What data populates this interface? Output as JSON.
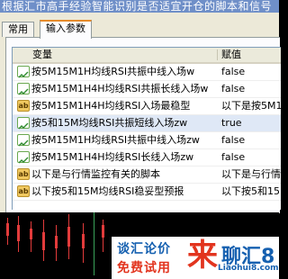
{
  "window": {
    "title": "根据汇市高手经验智能识别是否适宜开仓的脚本和信号"
  },
  "tabs": [
    {
      "label": "常用"
    },
    {
      "label": "输入参数"
    }
  ],
  "table": {
    "columns": [
      "变量",
      "赋值"
    ],
    "rows": [
      {
        "icon": "chart-icon",
        "name": "按5M15M1H均线RSI共振中线入场w",
        "value": "false"
      },
      {
        "icon": "chart-icon",
        "name": "按5M15M1H4H均线RSI共振长线入场w",
        "value": "false"
      },
      {
        "icon": "ab-icon",
        "name": "按5M15M1H4H均线RSI入场最稳型",
        "value": "以下是按5M15M"
      },
      {
        "icon": "chart-icon",
        "name": "按5和15M均线RSI共振短线入场zw",
        "value": "true",
        "selected": true
      },
      {
        "icon": "chart-icon",
        "name": "按5M15M1H均线RSI共振中线入场zw",
        "value": "false"
      },
      {
        "icon": "chart-icon",
        "name": "按5M15M1H4H均线RSI长线入场zw",
        "value": "false"
      },
      {
        "icon": "ab-icon",
        "name": "以下是与行情监控有关的脚本",
        "value": "以下是与行情监"
      },
      {
        "icon": "ab-icon",
        "name": "以下按5和15M均线RSI稳妥型预报",
        "value": "以下按5和15M均"
      }
    ]
  },
  "ad": {
    "line1": "谈汇论价",
    "line2": "免费试用",
    "big": "来",
    "brand": "聊汇8",
    "url": "Liaohui8.com"
  },
  "colors": {
    "accent_tab": "#e68b2c",
    "selected_row": "#dfe8f6",
    "ad_red": "#e2341e",
    "ad_blue": "#1560b0"
  }
}
